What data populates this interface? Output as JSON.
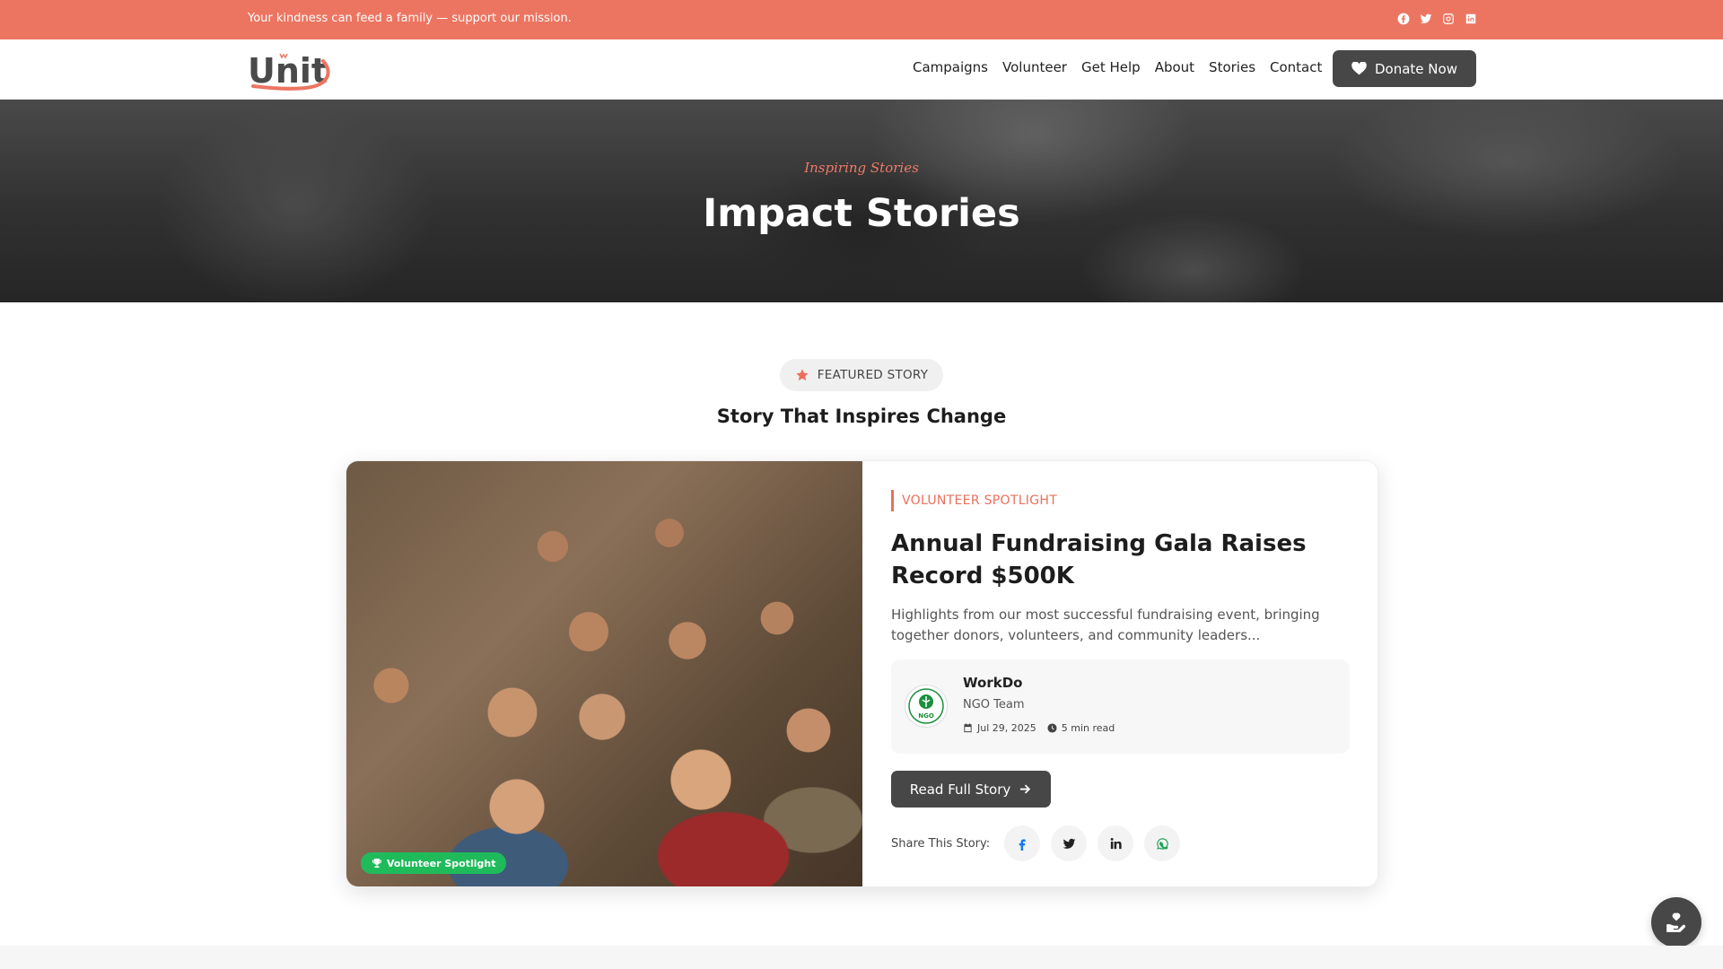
{
  "topbar": {
    "message": "Your kindness can feed a family — support our mission.",
    "socials": [
      "facebook-icon",
      "twitter-icon",
      "instagram-icon",
      "linkedin-icon"
    ]
  },
  "header": {
    "logo_text": "Unity",
    "nav": [
      "Campaigns",
      "Volunteer",
      "Get Help",
      "About",
      "Stories",
      "Contact"
    ],
    "donate_label": "Donate Now"
  },
  "hero": {
    "eyebrow": "Inspiring Stories",
    "title": "Impact Stories"
  },
  "featured": {
    "badge_label": "FEATURED STORY",
    "section_title": "Story That Inspires Change",
    "image_label": "Volunteer Spotlight",
    "category": "VOLUNTEER SPOTLIGHT",
    "title": "Annual Fundraising Gala Raises Record $500K",
    "excerpt": "Highlights from our most successful fundraising event, bringing together donors, volunteers, and community leaders...",
    "author": {
      "name": "WorkDo",
      "role": "NGO Team",
      "avatar_text": "NGO",
      "date": "Jul 29, 2025",
      "read_time": "5 min read"
    },
    "read_button": "Read Full Story",
    "share_label": "Share This Story:"
  },
  "colors": {
    "brand": "#ec7561",
    "dark_button": "#474747",
    "badge_green": "#1fbb5b"
  }
}
